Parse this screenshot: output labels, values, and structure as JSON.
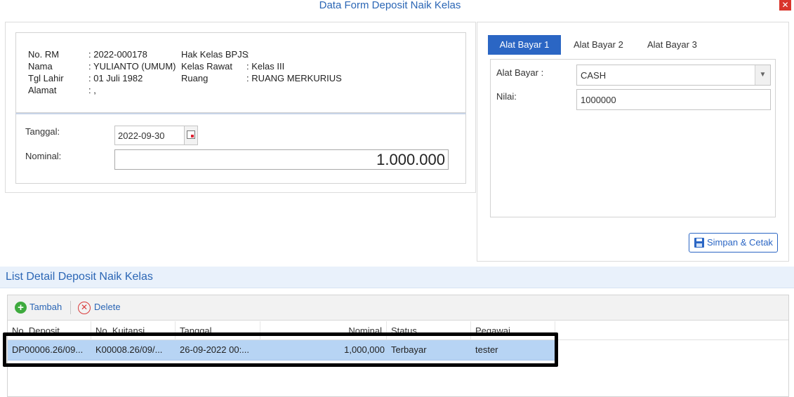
{
  "window": {
    "title": "Data Form Deposit Naik Kelas",
    "close_glyph": "✕"
  },
  "patient": {
    "no_rm_label": "No. RM",
    "no_rm_value": ": 2022-000178",
    "nama_label": "Nama",
    "nama_value": ": YULIANTO (UMUM)",
    "tgl_lahir_label": "Tgl Lahir",
    "tgl_lahir_value": ": 01 Juli 1982",
    "alamat_label": "Alamat",
    "alamat_value": ": ,",
    "hak_kelas_label": "Hak Kelas BPJS",
    "hak_kelas_value": ":",
    "kelas_rawat_label": "Kelas Rawat",
    "kelas_rawat_value": ": Kelas III",
    "ruang_label": "Ruang",
    "ruang_value": ": RUANG MERKURIUS"
  },
  "form": {
    "tanggal_label": "Tanggal:",
    "tanggal_value": "2022-09-30",
    "nominal_label": "Nominal:",
    "nominal_value": "1.000.000"
  },
  "payment": {
    "tabs": [
      {
        "label": "Alat Bayar 1",
        "active": true
      },
      {
        "label": "Alat Bayar 2",
        "active": false
      },
      {
        "label": "Alat Bayar 3",
        "active": false
      }
    ],
    "alat_bayar_label": "Alat Bayar :",
    "alat_bayar_value": "CASH",
    "nilai_label": "Nilai:",
    "nilai_value": "1000000",
    "save_label": "Simpan & Cetak"
  },
  "list": {
    "title": "List Detail Deposit Naik Kelas",
    "toolbar": {
      "add_label": "Tambah",
      "delete_label": "Delete"
    },
    "columns": [
      "No. Deposit",
      "No. Kuitansi",
      "Tanggal",
      "Nominal",
      "Status",
      "Pegawai"
    ],
    "rows": [
      {
        "no_deposit": "DP00006.26/09...",
        "no_kuitansi": "K00008.26/09/...",
        "tanggal": "26-09-2022 00:...",
        "nominal": "1,000,000",
        "status": "Terbayar",
        "pegawai": "tester"
      }
    ]
  },
  "colors": {
    "accent": "#2b66c4",
    "title_blue": "#2b66b5",
    "row_selected": "#b7d4f4",
    "close_red": "#d9342b"
  }
}
